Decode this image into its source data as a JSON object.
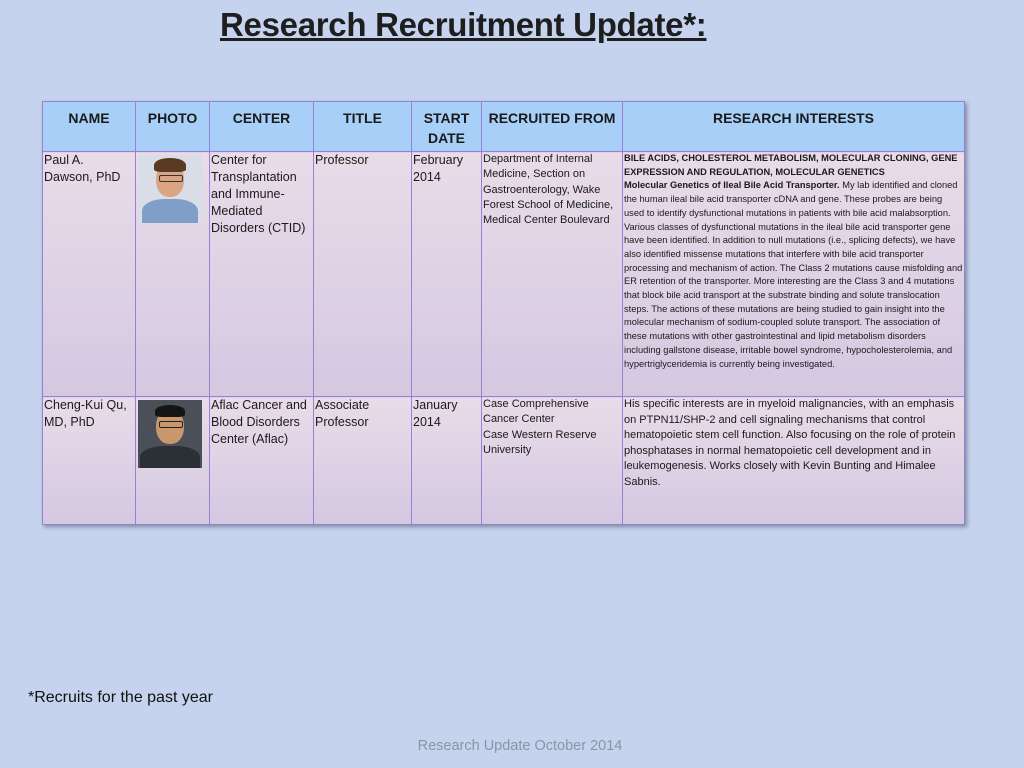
{
  "slide": {
    "title": "Research Recruitment Update*:",
    "footnote": "*Recruits for the past year",
    "footer": "Research Update October 2014"
  },
  "table": {
    "headers": {
      "name": "NAME",
      "photo": "PHOTO",
      "center": "CENTER",
      "title": "TITLE",
      "start_date": "START DATE",
      "recruited_from": "RECRUITED FROM",
      "research_interests": "RESEARCH INTERESTS"
    },
    "rows": [
      {
        "name": "Paul A. Dawson, PhD",
        "center": "Center for Transplantation and Immune-Mediated Disorders (CTID)",
        "title": "Professor",
        "start_date": "February 2014",
        "recruited_from": "Department of Internal Medicine, Section on Gastroenterology, Wake Forest School of Medicine, Medical Center Boulevard",
        "interests_heading": "BILE ACIDS, CHOLESTEROL METABOLISM, MOLECULAR CLONING, GENE EXPRESSION AND REGULATION, MOLECULAR GENETICS",
        "interests_subheading": "Molecular Genetics of Ileal Bile Acid Transporter.",
        "interests_text": " My lab identified and cloned the human ileal bile acid transporter cDNA and gene. These probes are being used to identify dysfunctional mutations in patients with bile acid malabsorption. Various classes of dysfunctional mutations in the ileal bile acid transporter gene have been identified. In addition to null mutations (i.e., splicing defects), we have also identified missense mutations that interfere with bile acid transporter processing and mechanism of action. The Class 2 mutations cause misfolding and ER retention of the transporter. More interesting are the Class 3 and 4 mutations that block bile acid transport at the substrate binding and solute translocation steps. The actions of these mutations are being studied to gain insight into the molecular mechanism of sodium-coupled solute transport. The association of these mutations with other gastrointestinal and lipid metabolism disorders including gallstone disease, irritable bowel syndrome, hypocholesterolemia, and hypertriglyceridemia is currently being investigated."
      },
      {
        "name": "Cheng-Kui Qu, MD, PhD",
        "center": "Aflac Cancer and Blood Disorders Center (Aflac)",
        "title": "Associate Professor",
        "start_date": "January 2014",
        "recruited_from_line1": "Case Comprehensive Cancer Center",
        "recruited_from_line2": "Case Western Reserve University",
        "interests_text": "His specific interests are in myeloid malignancies, with an emphasis on PTPN11/SHP-2 and cell signaling mechanisms that control hematopoietic stem cell function. Also focusing on the role of protein phosphatases in normal hematopoietic cell development and in leukemogenesis. Works closely with Kevin Bunting and Himalee Sabnis."
      }
    ]
  }
}
